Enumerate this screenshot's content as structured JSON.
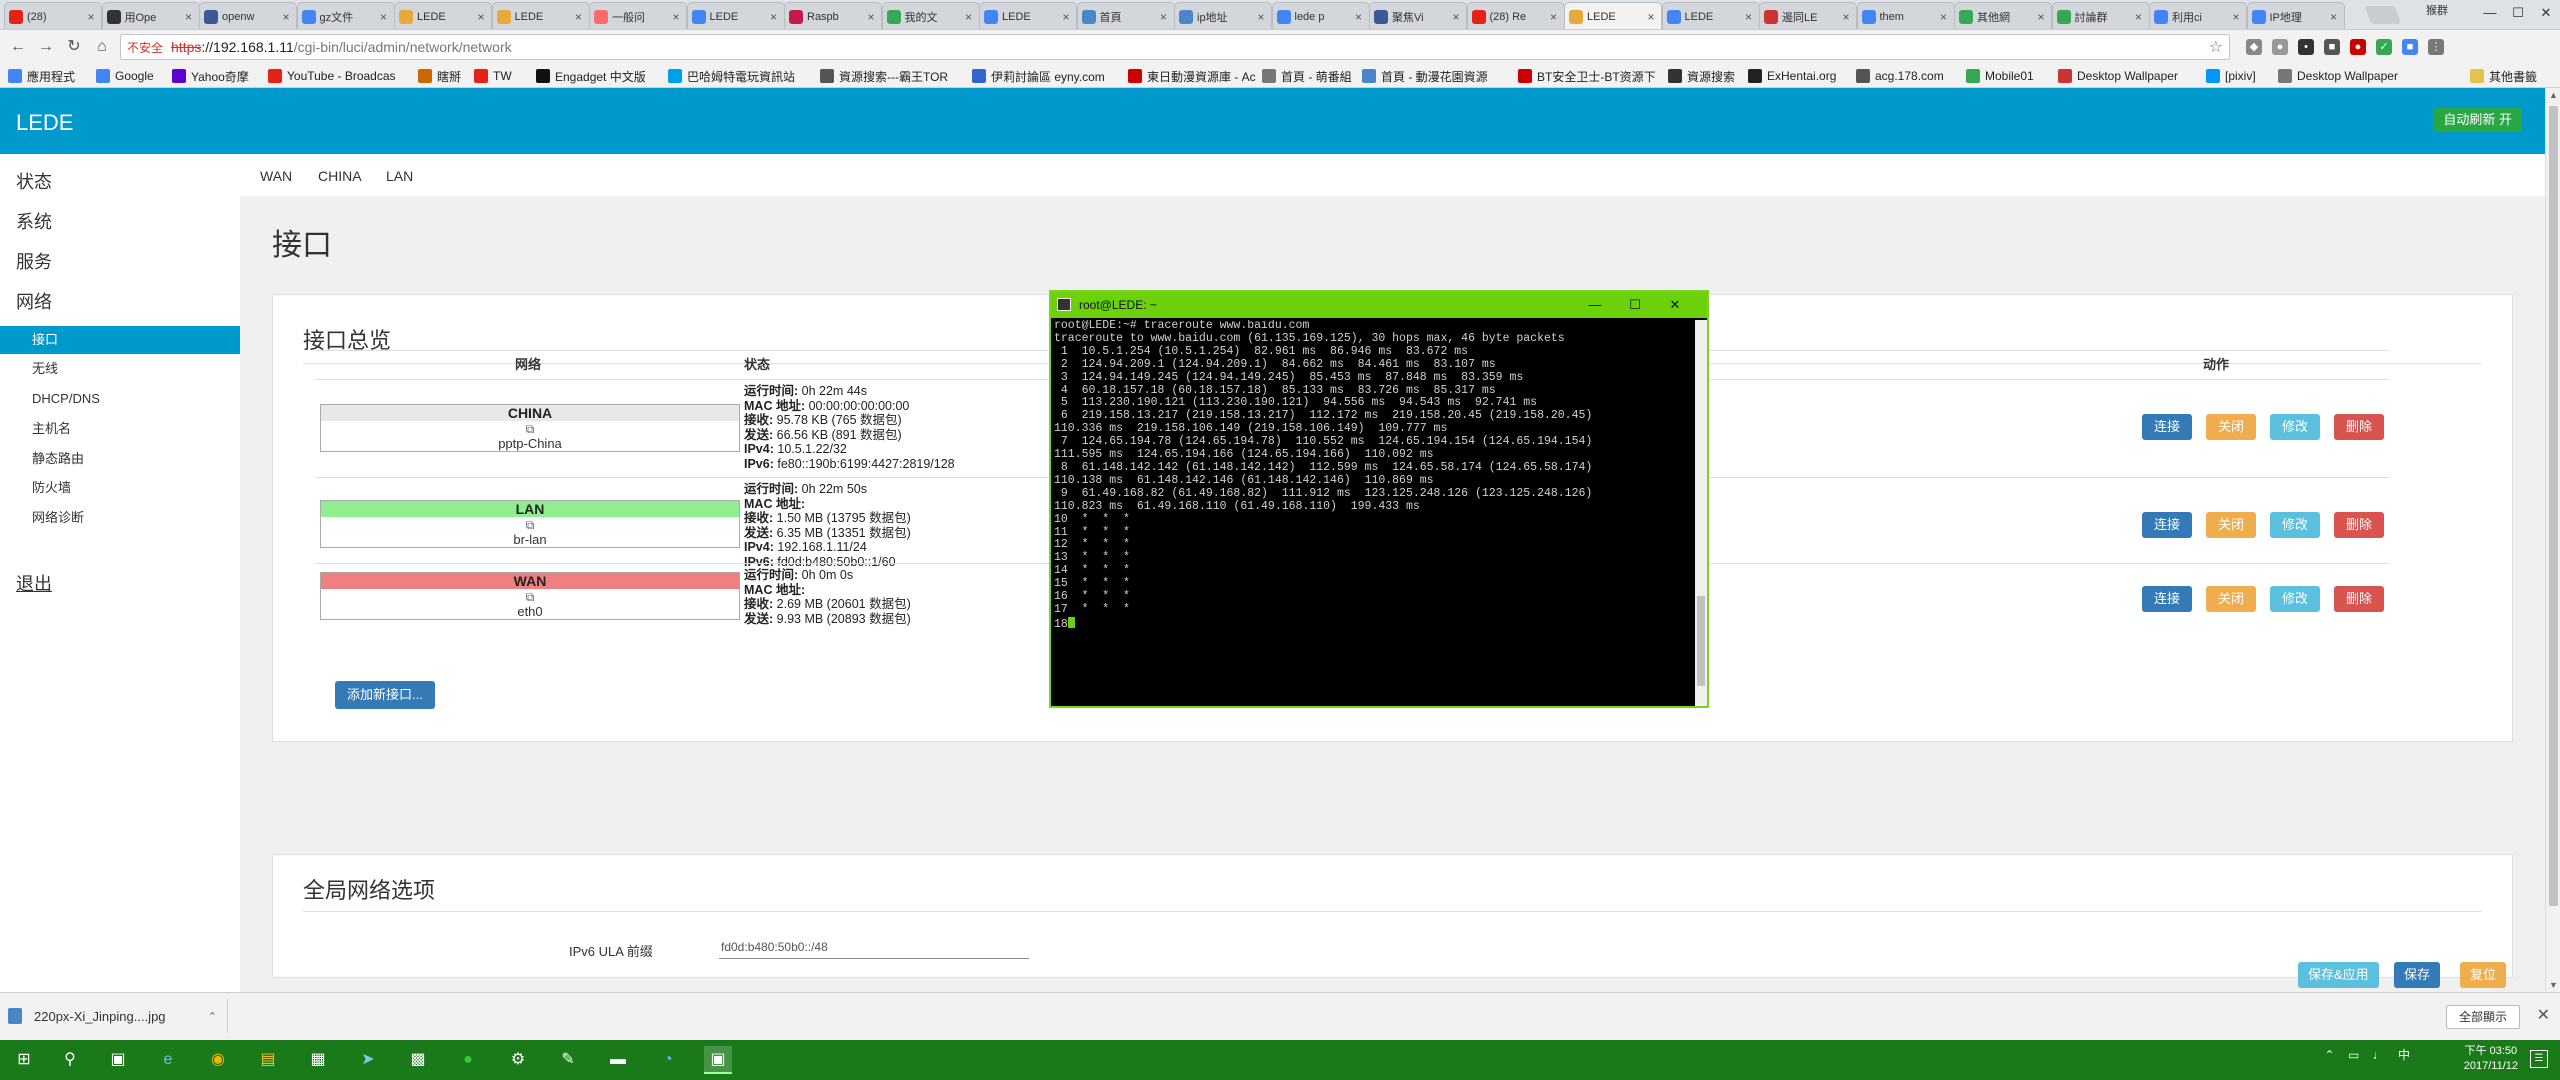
{
  "browser": {
    "tabs": [
      {
        "label": "(28)",
        "color": "#e62117",
        "icon": "youtube-icon"
      },
      {
        "label": "用Ope",
        "color": "#333333",
        "icon": "github-icon"
      },
      {
        "label": "openw",
        "color": "#3b5998",
        "icon": "page-icon"
      },
      {
        "label": "gz文件",
        "color": "#4285f4",
        "icon": "google-icon"
      },
      {
        "label": "LEDE",
        "color": "#e8a93a",
        "icon": "lede-icon"
      },
      {
        "label": "LEDE",
        "color": "#e8a93a",
        "icon": "lede-icon"
      },
      {
        "label": "一般问",
        "color": "#ff6a6a",
        "icon": "page-icon"
      },
      {
        "label": "LEDE",
        "color": "#4285f4",
        "icon": "google-icon"
      },
      {
        "label": "Raspb",
        "color": "#c51a4a",
        "icon": "raspberry-icon"
      },
      {
        "label": "我的文",
        "color": "#34a853",
        "icon": "page-icon"
      },
      {
        "label": "LEDE",
        "color": "#4285f4",
        "icon": "google-icon"
      },
      {
        "label": "首頁",
        "color": "#4a86c8",
        "icon": "page-icon"
      },
      {
        "label": "ip地址",
        "color": "#4a86c8",
        "icon": "page-icon"
      },
      {
        "label": "lede p",
        "color": "#4285f4",
        "icon": "google-icon"
      },
      {
        "label": "聚焦Vi",
        "color": "#3b5998",
        "icon": "page-icon"
      },
      {
        "label": "(28) Re",
        "color": "#e62117",
        "icon": "youtube-icon"
      },
      {
        "label": "LEDE",
        "color": "#e8a93a",
        "icon": "lede-icon",
        "active": true
      },
      {
        "label": "LEDE",
        "color": "#4285f4",
        "icon": "google-icon"
      },
      {
        "label": "邊同LE",
        "color": "#cc3333",
        "icon": "page-icon"
      },
      {
        "label": "them",
        "color": "#4285f4",
        "icon": "google-icon"
      },
      {
        "label": "其他網",
        "color": "#34a853",
        "icon": "page-icon"
      },
      {
        "label": "討論群",
        "color": "#34a853",
        "icon": "page-icon"
      },
      {
        "label": "利用ci",
        "color": "#4285f4",
        "icon": "page-icon"
      },
      {
        "label": "IP地理",
        "color": "#4285f4",
        "icon": "page-icon"
      }
    ],
    "profile_label": "猴群",
    "url_warning": "不安全",
    "url_scheme": "https",
    "url_host": "://192.168.1.11",
    "url_path": "/cgi-bin/luci/admin/network/network",
    "bookmarks": [
      {
        "label": "應用程式",
        "color": "#4285f4"
      },
      {
        "label": "Google",
        "color": "#4285f4"
      },
      {
        "label": "Yahoo奇摩",
        "color": "#6001d2"
      },
      {
        "label": "YouTube - Broadcas",
        "color": "#e62117"
      },
      {
        "label": "瞎掰",
        "color": "#cc6600"
      },
      {
        "label": "TW",
        "color": "#e62117"
      },
      {
        "label": "Engadget 中文版",
        "color": "#111111"
      },
      {
        "label": "巴哈姆特電玩資訊站",
        "color": "#00a0e9"
      },
      {
        "label": "資源搜索---霸王TOR",
        "color": "#555555"
      },
      {
        "label": "伊莉討論區 eyny.com",
        "color": "#3366cc"
      },
      {
        "label": "東日動漫資源庫 - Ac",
        "color": "#cc0000"
      },
      {
        "label": "首頁 - 萌番組",
        "color": "#777777"
      },
      {
        "label": "首頁 - 動漫花園資源",
        "color": "#4a86c8"
      },
      {
        "label": "BT安全卫士-BT资源下",
        "color": "#cc0000"
      },
      {
        "label": "資源搜索",
        "color": "#333333"
      },
      {
        "label": "ExHentai.org",
        "color": "#222222"
      },
      {
        "label": "acg.178.com",
        "color": "#555555"
      },
      {
        "label": "Mobile01",
        "color": "#34a853"
      },
      {
        "label": "Desktop Wallpaper",
        "color": "#cc3333"
      },
      {
        "label": "[pixiv]",
        "color": "#0096fa"
      },
      {
        "label": "Desktop Wallpaper",
        "color": "#777777"
      }
    ],
    "other_bookmarks": "其他書籤"
  },
  "lede": {
    "brand": "LEDE",
    "auto_refresh": "自动刷新 开",
    "menu": {
      "status": "状态",
      "system": "系统",
      "services": "服务",
      "network": "网络",
      "network_items": [
        "接口",
        "无线",
        "DHCP/DNS",
        "主机名",
        "静态路由",
        "防火墙",
        "网络诊断"
      ],
      "logout": "退出"
    },
    "subtabs": [
      "WAN",
      "CHINA",
      "LAN"
    ],
    "page_title": "接口",
    "overview": {
      "title": "接口总览",
      "col_network": "网络",
      "col_status": "状态",
      "col_actions": "动作",
      "interfaces": [
        {
          "name": "CHINA",
          "device": "pptp-China",
          "name_color": "#e8e8e8",
          "uptime_label": "运行时间:",
          "uptime": "0h 22m 44s",
          "mac_label": "MAC 地址:",
          "mac": "00:00:00:00:00:00",
          "rx_label": "接收:",
          "rx": "95.78 KB (765 数据包)",
          "tx_label": "发送:",
          "tx": "66.56 KB (891 数据包)",
          "ipv4_label": "IPv4:",
          "ipv4": "10.5.1.22/32",
          "ipv6_label": "IPv6:",
          "ipv6": "fe80::190b:6199:4427:2819/128"
        },
        {
          "name": "LAN",
          "device": "br-lan",
          "name_color": "#90ee90",
          "uptime_label": "运行时间:",
          "uptime": "0h 22m 50s",
          "mac_label": "MAC 地址:",
          "mac": "",
          "rx_label": "接收:",
          "rx": "1.50 MB (13795 数据包)",
          "tx_label": "发送:",
          "tx": "6.35 MB (13351 数据包)",
          "ipv4_label": "IPv4:",
          "ipv4": "192.168.1.11/24",
          "ipv6_label": "IPv6:",
          "ipv6": "fd0d:b480:50b0::1/60"
        },
        {
          "name": "WAN",
          "device": "eth0",
          "name_color": "#f08080",
          "uptime_label": "运行时间:",
          "uptime": "0h 0m 0s",
          "mac_label": "MAC 地址:",
          "mac": "",
          "rx_label": "接收:",
          "rx": "2.69 MB (20601 数据包)",
          "tx_label": "发送:",
          "tx": "9.93 MB (20893 数据包)"
        }
      ],
      "actions": {
        "connect": "连接",
        "stop": "关闭",
        "edit": "修改",
        "delete": "删除"
      },
      "add_interface": "添加新接口..."
    },
    "global": {
      "title": "全局网络选项",
      "ula_label": "IPv6 ULA 前缀",
      "ula_value": "fd0d:b480:50b0::/48"
    },
    "bottom_buttons": {
      "save_apply": "保存&应用",
      "save": "保存",
      "reset": "复位"
    }
  },
  "terminal": {
    "title": "root@LEDE: ~",
    "lines": [
      "root@LEDE:~# traceroute www.baidu.com",
      "traceroute to www.baidu.com (61.135.169.125), 30 hops max, 46 byte packets",
      " 1  10.5.1.254 (10.5.1.254)  82.961 ms  86.946 ms  83.672 ms",
      " 2  124.94.209.1 (124.94.209.1)  84.662 ms  84.461 ms  83.107 ms",
      " 3  124.94.149.245 (124.94.149.245)  85.453 ms  87.848 ms  83.359 ms",
      " 4  60.18.157.18 (60.18.157.18)  85.133 ms  83.726 ms  85.317 ms",
      " 5  113.230.190.121 (113.230.190.121)  94.556 ms  94.543 ms  92.741 ms",
      " 6  219.158.13.217 (219.158.13.217)  112.172 ms  219.158.20.45 (219.158.20.45)",
      "110.336 ms  219.158.106.149 (219.158.106.149)  109.777 ms",
      " 7  124.65.194.78 (124.65.194.78)  110.552 ms  124.65.194.154 (124.65.194.154)",
      "111.595 ms  124.65.194.166 (124.65.194.166)  110.092 ms",
      " 8  61.148.142.142 (61.148.142.142)  112.599 ms  124.65.58.174 (124.65.58.174)",
      "110.138 ms  61.148.142.146 (61.148.142.146)  110.869 ms",
      " 9  61.49.168.82 (61.49.168.82)  111.912 ms  123.125.248.126 (123.125.248.126)",
      "110.823 ms  61.49.168.110 (61.49.168.110)  199.433 ms",
      "10  *  *  *",
      "11  *  *  *",
      "12  *  *  *",
      "13  *  *  *",
      "14  *  *  *",
      "15  *  *  *",
      "16  *  *  *",
      "17  *  *  *",
      "18"
    ]
  },
  "downloads": {
    "file": "220px-Xi_Jinping....jpg",
    "show_all": "全部顯示"
  },
  "taskbar": {
    "clock_time": "下午 03:50",
    "clock_date": "2017/11/12",
    "ime": "中"
  }
}
